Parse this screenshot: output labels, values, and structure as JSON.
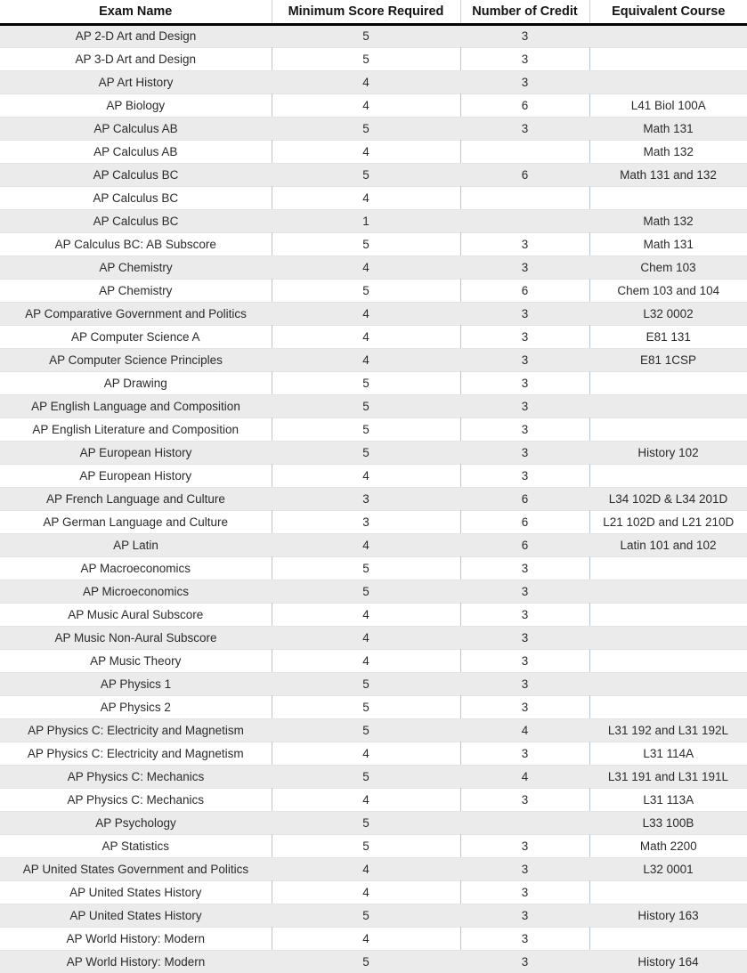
{
  "table": {
    "columns": [
      {
        "key": "exam",
        "label": "Exam Name"
      },
      {
        "key": "score",
        "label": "Minimum Score Required"
      },
      {
        "key": "credit",
        "label": "Number of Credit"
      },
      {
        "key": "equiv",
        "label": "Equivalent Course"
      }
    ],
    "rows": [
      {
        "exam": "AP 2-D Art and Design",
        "score": "5",
        "credit": "3",
        "equiv": ""
      },
      {
        "exam": "AP 3-D Art and Design",
        "score": "5",
        "credit": "3",
        "equiv": ""
      },
      {
        "exam": "AP Art History",
        "score": "4",
        "credit": "3",
        "equiv": ""
      },
      {
        "exam": "AP Biology",
        "score": "4",
        "credit": "6",
        "equiv": "L41 Biol 100A"
      },
      {
        "exam": "AP Calculus AB",
        "score": "5",
        "credit": "3",
        "equiv": "Math 131"
      },
      {
        "exam": "AP Calculus AB",
        "score": "4",
        "credit": "",
        "equiv": "Math 132"
      },
      {
        "exam": "AP Calculus BC",
        "score": "5",
        "credit": "6",
        "equiv": "Math 131 and 132"
      },
      {
        "exam": "AP Calculus BC",
        "score": "4",
        "credit": "",
        "equiv": ""
      },
      {
        "exam": "AP Calculus BC",
        "score": "1",
        "credit": "",
        "equiv": "Math 132"
      },
      {
        "exam": "AP Calculus BC: AB Subscore",
        "score": "5",
        "credit": "3",
        "equiv": "Math 131"
      },
      {
        "exam": "AP Chemistry",
        "score": "4",
        "credit": "3",
        "equiv": "Chem 103"
      },
      {
        "exam": "AP Chemistry",
        "score": "5",
        "credit": "6",
        "equiv": "Chem 103 and 104"
      },
      {
        "exam": "AP Comparative Government and Politics",
        "score": "4",
        "credit": "3",
        "equiv": "L32 0002"
      },
      {
        "exam": "AP Computer Science A",
        "score": "4",
        "credit": "3",
        "equiv": "E81 131"
      },
      {
        "exam": "AP Computer Science Principles",
        "score": "4",
        "credit": "3",
        "equiv": "E81 1CSP"
      },
      {
        "exam": "AP Drawing",
        "score": "5",
        "credit": "3",
        "equiv": ""
      },
      {
        "exam": "AP English Language and Composition",
        "score": "5",
        "credit": "3",
        "equiv": ""
      },
      {
        "exam": "AP English Literature and Composition",
        "score": "5",
        "credit": "3",
        "equiv": ""
      },
      {
        "exam": "AP European History",
        "score": "5",
        "credit": "3",
        "equiv": "History 102"
      },
      {
        "exam": "AP European History",
        "score": "4",
        "credit": "3",
        "equiv": ""
      },
      {
        "exam": "AP French Language and Culture",
        "score": "3",
        "credit": "6",
        "equiv": "L34 102D & L34 201D"
      },
      {
        "exam": "AP German Language and Culture",
        "score": "3",
        "credit": "6",
        "equiv": "L21 102D and L21 210D"
      },
      {
        "exam": "AP Latin",
        "score": "4",
        "credit": "6",
        "equiv": "Latin 101 and 102"
      },
      {
        "exam": "AP Macroeconomics",
        "score": "5",
        "credit": "3",
        "equiv": ""
      },
      {
        "exam": "AP Microeconomics",
        "score": "5",
        "credit": "3",
        "equiv": ""
      },
      {
        "exam": "AP Music Aural Subscore",
        "score": "4",
        "credit": "3",
        "equiv": ""
      },
      {
        "exam": "AP Music Non-Aural Subscore",
        "score": "4",
        "credit": "3",
        "equiv": ""
      },
      {
        "exam": "AP Music Theory",
        "score": "4",
        "credit": "3",
        "equiv": ""
      },
      {
        "exam": "AP Physics 1",
        "score": "5",
        "credit": "3",
        "equiv": ""
      },
      {
        "exam": "AP Physics 2",
        "score": "5",
        "credit": "3",
        "equiv": ""
      },
      {
        "exam": "AP Physics C: Electricity and Magnetism",
        "score": "5",
        "credit": "4",
        "equiv": "L31 192 and L31 192L"
      },
      {
        "exam": "AP Physics C: Electricity and Magnetism",
        "score": "4",
        "credit": "3",
        "equiv": "L31 114A"
      },
      {
        "exam": "AP Physics C: Mechanics",
        "score": "5",
        "credit": "4",
        "equiv": "L31 191 and L31 191L"
      },
      {
        "exam": "AP Physics C: Mechanics",
        "score": "4",
        "credit": "3",
        "equiv": "L31 113A"
      },
      {
        "exam": "AP Psychology",
        "score": "5",
        "credit": "",
        "equiv": "L33 100B"
      },
      {
        "exam": "AP Statistics",
        "score": "5",
        "credit": "3",
        "equiv": "Math 2200"
      },
      {
        "exam": "AP United States Government and Politics",
        "score": "4",
        "credit": "3",
        "equiv": "L32 0001"
      },
      {
        "exam": "AP United States History",
        "score": "4",
        "credit": "3",
        "equiv": ""
      },
      {
        "exam": "AP United States History",
        "score": "5",
        "credit": "3",
        "equiv": "History 163"
      },
      {
        "exam": "AP World History: Modern",
        "score": "4",
        "credit": "3",
        "equiv": ""
      },
      {
        "exam": "AP World History: Modern",
        "score": "5",
        "credit": "3",
        "equiv": "History 164"
      }
    ]
  },
  "colors": {
    "header_text": "#141414",
    "header_rule": "#000000",
    "row_shaded": "#ebebeb",
    "row_plain": "#ffffff",
    "column_divider": "#b9c5cd",
    "row_divider": "#e4e4e4",
    "body_text": "#2b2b2b"
  }
}
